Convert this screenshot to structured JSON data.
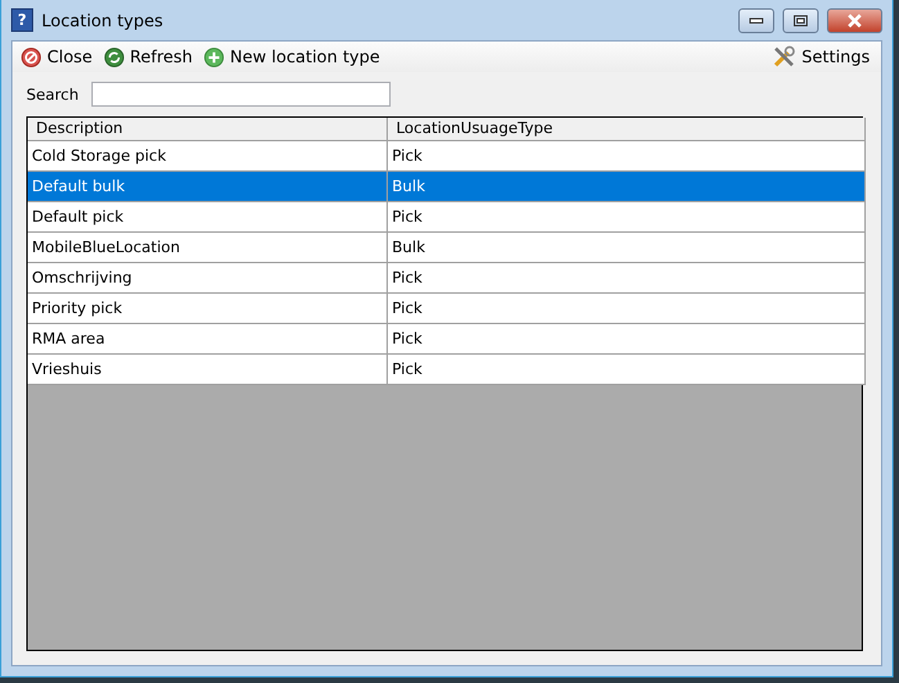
{
  "window": {
    "title": "Location types",
    "icon": "?"
  },
  "toolbar": {
    "items": [
      {
        "label": "Close",
        "kind": "close"
      },
      {
        "label": "Refresh",
        "kind": "refresh"
      },
      {
        "label": "New location type",
        "kind": "add"
      }
    ],
    "settings": {
      "label": "Settings"
    }
  },
  "search": {
    "label": "Search"
  },
  "table": {
    "columns": [
      "Description",
      "LocationUsuageType"
    ],
    "rows": [
      {
        "cells": [
          "Cold Storage pick",
          "Pick"
        ],
        "selected": false
      },
      {
        "cells": [
          "Default bulk",
          "Bulk"
        ],
        "selected": true
      },
      {
        "cells": [
          "Default pick",
          "Pick"
        ],
        "selected": false
      },
      {
        "cells": [
          "MobileBlueLocation",
          "Bulk"
        ],
        "selected": false
      },
      {
        "cells": [
          "Omschrijving",
          "Pick"
        ],
        "selected": false
      },
      {
        "cells": [
          "Priority pick",
          "Pick"
        ],
        "selected": false
      },
      {
        "cells": [
          "RMA area",
          "Pick"
        ],
        "selected": false
      },
      {
        "cells": [
          "Vrieshuis",
          "Pick"
        ],
        "selected": false
      }
    ]
  }
}
